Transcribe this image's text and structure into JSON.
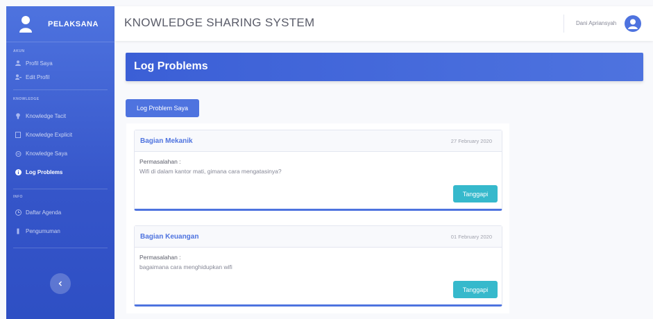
{
  "sidebar": {
    "brand": "PELAKSANA",
    "headings": [
      "Akun",
      "Knowledge",
      "Info"
    ],
    "items": [
      {
        "label": "Profil Saya",
        "icon": "user-icon"
      },
      {
        "label": "Edit Profil",
        "icon": "user-edit-icon"
      },
      {
        "label": "Knowledge Tacit",
        "icon": "lightbulb-icon"
      },
      {
        "label": "Knowledge Explicit",
        "icon": "book-icon"
      },
      {
        "label": "Knowledge Saya",
        "icon": "folder-icon"
      },
      {
        "label": "Log Problems",
        "icon": "info-circle-icon",
        "active": true
      },
      {
        "label": "Daftar Agenda",
        "icon": "calendar-icon"
      },
      {
        "label": "Pengumuman",
        "icon": "bullhorn-icon"
      }
    ],
    "toggle_icon": "chevron-left-icon"
  },
  "topbar": {
    "title": "KNOWLEDGE SHARING SYSTEM",
    "user_name": "Dani Apriansyah"
  },
  "page": {
    "title": "Log Problems",
    "button_label": "Log Problem Saya"
  },
  "problems": [
    {
      "division": "Bagian Mekanik",
      "date": "27 February 2020",
      "label": "Permasalahan :",
      "description": "Wifi di dalam kantor mati, gimana cara mengatasinya?",
      "reply_label": "Tanggapi"
    },
    {
      "division": "Bagian Keuangan",
      "date": "01 February 2020",
      "label": "Permasalahan :",
      "description": "bagaimana cara menghidupkan wifi",
      "reply_label": "Tanggapi"
    }
  ],
  "colors": {
    "primary": "#4e73df",
    "info": "#36b9cc",
    "text": "#5a5c69",
    "muted": "#858796"
  }
}
